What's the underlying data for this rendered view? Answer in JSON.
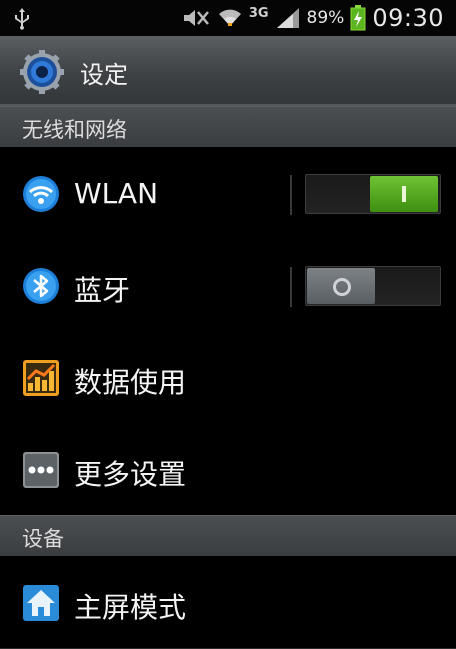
{
  "status_bar": {
    "network_type": "3G",
    "battery_percent": "89%",
    "time": "09:30",
    "icons": [
      "usb-icon",
      "mute-icon",
      "wifi-icon",
      "signal-icon",
      "battery-icon"
    ]
  },
  "action_bar": {
    "title": "设定",
    "icon": "settings-gear-icon"
  },
  "sections": [
    {
      "header": "无线和网络",
      "items": [
        {
          "label": "WLAN",
          "icon": "wifi-icon",
          "toggle": "on"
        },
        {
          "label": "蓝牙",
          "icon": "bluetooth-icon",
          "toggle": "off"
        },
        {
          "label": "数据使用",
          "icon": "data-usage-icon"
        },
        {
          "label": "更多设置",
          "icon": "more-settings-icon"
        }
      ]
    },
    {
      "header": "设备",
      "items": [
        {
          "label": "主屏模式",
          "icon": "home-screen-icon"
        }
      ]
    }
  ],
  "colors": {
    "toggle_on": "#4f9e1c",
    "toggle_off": "#6b7075",
    "section_bg": "#43464a",
    "accent_blue": "#1e88e5"
  }
}
